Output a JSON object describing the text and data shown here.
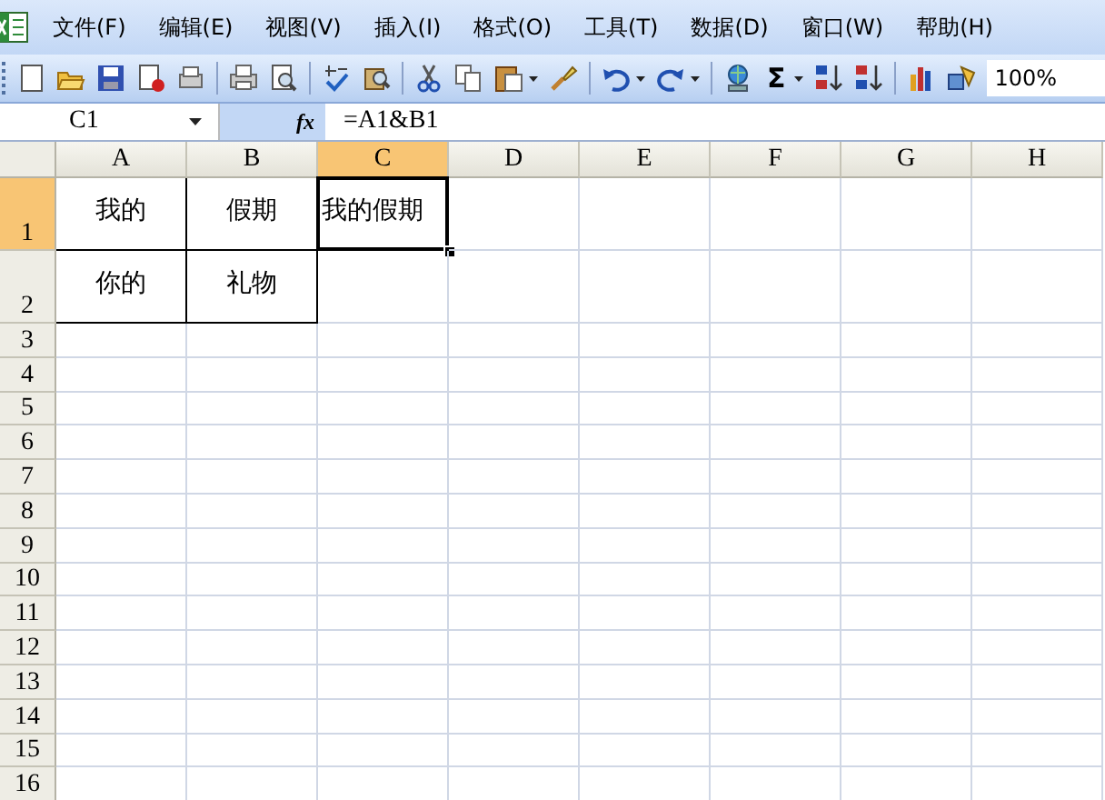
{
  "menu_bar": {
    "items": [
      "文件(F)",
      "编辑(E)",
      "视图(V)",
      "插入(I)",
      "格式(O)",
      "工具(T)",
      "数据(D)",
      "窗口(W)",
      "帮助(H)"
    ]
  },
  "toolbar": {
    "items": [
      {
        "kind": "new"
      },
      {
        "kind": "open"
      },
      {
        "kind": "save"
      },
      {
        "kind": "permission"
      },
      {
        "kind": "mail"
      },
      {
        "kind": "sep"
      },
      {
        "kind": "print"
      },
      {
        "kind": "preview"
      },
      {
        "kind": "sep"
      },
      {
        "kind": "spelling"
      },
      {
        "kind": "research"
      },
      {
        "kind": "sep"
      },
      {
        "kind": "cut"
      },
      {
        "kind": "copy"
      },
      {
        "kind": "paste"
      },
      {
        "kind": "dropdown"
      },
      {
        "kind": "painter"
      },
      {
        "kind": "sep"
      },
      {
        "kind": "undo"
      },
      {
        "kind": "dropdown"
      },
      {
        "kind": "redo"
      },
      {
        "kind": "dropdown"
      },
      {
        "kind": "sep"
      },
      {
        "kind": "link"
      },
      {
        "kind": "sum",
        "text": "Σ"
      },
      {
        "kind": "dropdown"
      },
      {
        "kind": "sortasc"
      },
      {
        "kind": "sortdesc"
      },
      {
        "kind": "sep"
      },
      {
        "kind": "chart"
      },
      {
        "kind": "drawing"
      }
    ],
    "zoom": "100%"
  },
  "formula_bar": {
    "name_box": "C1",
    "function_label": "fx",
    "formula": "=A1&B1"
  },
  "sheet": {
    "columns": [
      {
        "label": "A",
        "selected": false
      },
      {
        "label": "B",
        "selected": false
      },
      {
        "label": "C",
        "selected": true
      },
      {
        "label": "D",
        "selected": false
      },
      {
        "label": "E",
        "selected": false
      },
      {
        "label": "F",
        "selected": false
      },
      {
        "label": "G",
        "selected": false
      },
      {
        "label": "H",
        "selected": false
      }
    ],
    "rows": [
      {
        "label": "1",
        "selected": true,
        "kind": "tall",
        "cells": [
          {
            "text": "我的",
            "bordered": true,
            "selected": false
          },
          {
            "text": "假期",
            "bordered": true,
            "selected": false
          },
          {
            "text": "我的假期",
            "bordered": false,
            "selected": true
          }
        ]
      },
      {
        "label": "2",
        "selected": false,
        "kind": "tall",
        "cells": [
          {
            "text": "你的",
            "bordered": true,
            "selected": false
          },
          {
            "text": "礼物",
            "bordered": true,
            "selected": false
          }
        ]
      },
      {
        "label": "3",
        "selected": false,
        "kind": "normal"
      },
      {
        "label": "4",
        "selected": false,
        "kind": "normal"
      },
      {
        "label": "5",
        "selected": false,
        "kind": "normal"
      },
      {
        "label": "6",
        "selected": false,
        "kind": "normal"
      },
      {
        "label": "7",
        "selected": false,
        "kind": "normal"
      },
      {
        "label": "8",
        "selected": false,
        "kind": "normal"
      },
      {
        "label": "9",
        "selected": false,
        "kind": "normal"
      },
      {
        "label": "10",
        "selected": false,
        "kind": "normal"
      },
      {
        "label": "11",
        "selected": false,
        "kind": "normal"
      },
      {
        "label": "12",
        "selected": false,
        "kind": "normal"
      },
      {
        "label": "13",
        "selected": false,
        "kind": "normal"
      },
      {
        "label": "14",
        "selected": false,
        "kind": "normal"
      },
      {
        "label": "15",
        "selected": false,
        "kind": "normal"
      },
      {
        "label": "16",
        "selected": false,
        "kind": "normal"
      }
    ]
  }
}
